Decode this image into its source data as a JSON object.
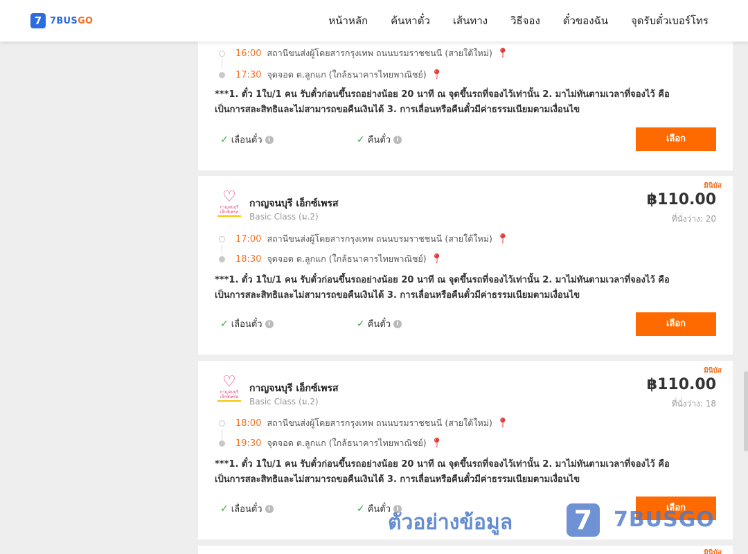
{
  "header": {
    "logo_badge": "7",
    "logo_text_a": "7BUS",
    "logo_text_b": "GO",
    "nav": [
      "หน้าหลัก",
      "ค้นหาตั๋ว",
      "เส้นทาง",
      "วิธีจอง",
      "ตั๋วของฉัน",
      "จุดรับตั๋วเบอร์โทร"
    ]
  },
  "cards": [
    {
      "stops": [
        {
          "time": "16:00",
          "place": "สถานีขนส่งผู้โดยสารกรุงเทพ ถนนบรมราชชนนี (สายใต้ใหม่)"
        },
        {
          "time": "17:30",
          "place": "จุดจอด ต.ลูกแก (ใกล้ธนาคารไทยพาณิชย์)"
        }
      ],
      "note_line1": "***1. ตั๋ว 1ใบ/1 คน รับตั๋วก่อนขึ้นรถอย่างน้อย 20 นาที ณ จุดขึ้นรถที่จองไว้เท่านั้น 2. มาไม่ทันตามเวลาที่จองไว้ คือ",
      "note_line2": "เป็นการสละสิทธิและไม่สามารถขอคืนเงินได้ 3. การเลื่อนหรือคืนตั๋วมีค่าธรรมเนียมตามเงื่อนไข",
      "feature_change": "เลื่อนตั๋ว",
      "feature_refund": "คืนตั๋ว",
      "select_label": "เลือก"
    },
    {
      "tag": "มินิบัส",
      "operator_logo_text": "กาญจนบุรี เอ็กซ์เพรส",
      "operator": "กาญจนบุรี เอ็กซ์เพรส",
      "class": "Basic Class (ม.2)",
      "price": "฿110.00",
      "seats": "ที่นั่งว่าง: 20",
      "stops": [
        {
          "time": "17:00",
          "place": "สถานีขนส่งผู้โดยสารกรุงเทพ ถนนบรมราชชนนี (สายใต้ใหม่)"
        },
        {
          "time": "18:30",
          "place": "จุดจอด ต.ลูกแก (ใกล้ธนาคารไทยพาณิชย์)"
        }
      ],
      "note_line1": "***1. ตั๋ว 1ใบ/1 คน รับตั๋วก่อนขึ้นรถอย่างน้อย 20 นาที ณ จุดขึ้นรถที่จองไว้เท่านั้น 2. มาไม่ทันตามเวลาที่จองไว้ คือ",
      "note_line2": "เป็นการสละสิทธิและไม่สามารถขอคืนเงินได้ 3. การเลื่อนหรือคืนตั๋วมีค่าธรรมเนียมตามเงื่อนไข",
      "feature_change": "เลื่อนตั๋ว",
      "feature_refund": "คืนตั๋ว",
      "select_label": "เลือก"
    },
    {
      "tag": "มินิบัส",
      "operator_logo_text": "กาญจนบุรี เอ็กซ์เพรส",
      "operator": "กาญจนบุรี เอ็กซ์เพรส",
      "class": "Basic Class (ม.2)",
      "price": "฿110.00",
      "seats": "ที่นั่งว่าง: 18",
      "stops": [
        {
          "time": "18:00",
          "place": "สถานีขนส่งผู้โดยสารกรุงเทพ ถนนบรมราชชนนี (สายใต้ใหม่)"
        },
        {
          "time": "19:30",
          "place": "จุดจอด ต.ลูกแก (ใกล้ธนาคารไทยพาณิชย์)"
        }
      ],
      "note_line1": "***1. ตั๋ว 1ใบ/1 คน รับตั๋วก่อนขึ้นรถอย่างน้อย 20 นาที ณ จุดขึ้นรถที่จองไว้เท่านั้น 2. มาไม่ทันตามเวลาที่จองไว้ คือ",
      "note_line2": "เป็นการสละสิทธิและไม่สามารถขอคืนเงินได้ 3. การเลื่อนหรือคืนตั๋วมีค่าธรรมเนียมตามเงื่อนไข",
      "feature_change": "เลื่อนตั๋ว",
      "feature_refund": "คืนตั๋ว",
      "select_label": "เลือก"
    },
    {
      "tag": "มินิบัส"
    }
  ],
  "watermark": {
    "text": "ตัวอย่างข้อมูล",
    "badge": "7",
    "brand": "7BUSGO"
  },
  "icons": {
    "check": "check-icon",
    "info": "info-icon",
    "pin": "map-pin-icon",
    "heart": "heart-logo-icon"
  },
  "colors": {
    "accent": "#ff6a00",
    "time": "#f37021",
    "check": "#2eab3c",
    "pin": "#e23b3b",
    "brand_blue": "#2d6be0"
  }
}
